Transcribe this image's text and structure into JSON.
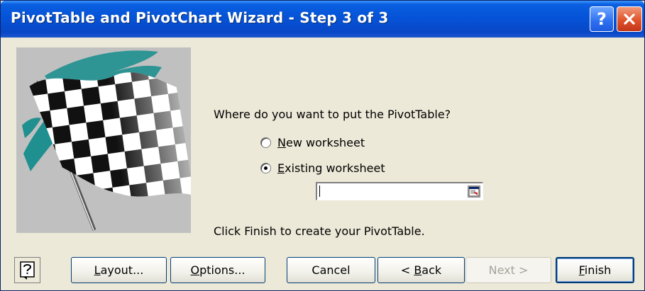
{
  "window": {
    "title": "PivotTable and PivotChart Wizard - Step 3 of 3",
    "help_button": "?"
  },
  "body": {
    "question": "Where do you want to put the PivotTable?",
    "options": [
      {
        "mnemonic": "N",
        "rest": "ew worksheet",
        "selected": false
      },
      {
        "mnemonic": "E",
        "rest": "xisting worksheet",
        "selected": true
      }
    ],
    "location_value": "",
    "finish_note": "Click Finish to create your PivotTable."
  },
  "buttons": {
    "layout": {
      "mnemonic": "L",
      "rest": "ayout..."
    },
    "options": {
      "mnemonic": "O",
      "rest": "ptions..."
    },
    "cancel": {
      "label": "Cancel"
    },
    "back": {
      "prefix": "< ",
      "mnemonic": "B",
      "rest": "ack"
    },
    "next": {
      "label": "Next >"
    },
    "finish": {
      "mnemonic": "F",
      "rest": "inish"
    }
  },
  "colors": {
    "titlebar": "#0553d8",
    "dialog_bg": "#ece9d8",
    "flag_panel_bg": "#c0c0c0",
    "teal_swoosh": "#1f8f8f"
  }
}
